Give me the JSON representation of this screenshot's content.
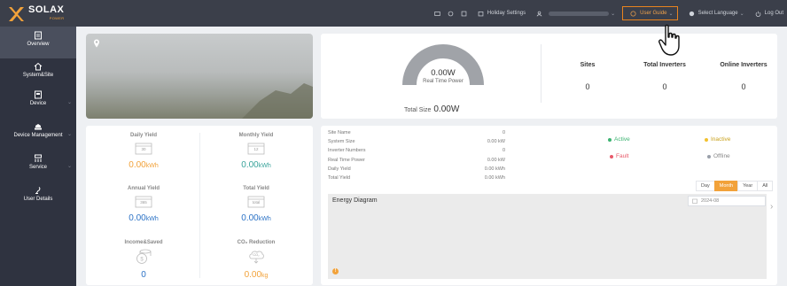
{
  "brand": {
    "name": "SOLAX",
    "sub": "POWER"
  },
  "topnav": {
    "holiday_settings": "Holiday Settings",
    "user_guide": "User Guide",
    "select_language": "Select Language",
    "log_out": "Log Out"
  },
  "sidebar": {
    "items": [
      {
        "label": "Overview",
        "icon": "overview-icon"
      },
      {
        "label": "System&Site",
        "icon": "home-icon"
      },
      {
        "label": "Device",
        "icon": "device-icon"
      },
      {
        "label": "Device Management",
        "icon": "device-management-icon"
      },
      {
        "label": "Service",
        "icon": "service-icon"
      },
      {
        "label": "User Details",
        "icon": "user-icon"
      }
    ]
  },
  "power": {
    "value": "0.00W",
    "label": "Real Time Power",
    "total_size_label": "Total Size",
    "total_size_value": "0.00W"
  },
  "stats": {
    "sites_label": "Sites",
    "sites_value": "0",
    "total_inverters_label": "Total Inverters",
    "total_inverters_value": "0",
    "online_inverters_label": "Online Inverters",
    "online_inverters_value": "0"
  },
  "yield": {
    "daily": {
      "label": "Daily Yield",
      "badge": "30",
      "value": "0.00",
      "unit": "kWh"
    },
    "monthly": {
      "label": "Monthly Yield",
      "badge": "12",
      "value": "0.00",
      "unit": "kWh"
    },
    "annual": {
      "label": "Annual Yield",
      "badge": "365",
      "value": "0.00",
      "unit": "kWh"
    },
    "total": {
      "label": "Total Yield",
      "badge": "total",
      "value": "0.00",
      "unit": "kWh"
    },
    "income": {
      "label": "Income&Saved",
      "value": "0"
    },
    "co2": {
      "label": "CO₂ Reduction",
      "badge": "CO₂",
      "value": "0.00",
      "unit": "kg"
    }
  },
  "site_info": [
    {
      "key": "Site Name",
      "value": "0"
    },
    {
      "key": "System Size",
      "value": "0.00 kW"
    },
    {
      "key": "Inverter Numbers",
      "value": "0"
    },
    {
      "key": "Real Time Power",
      "value": "0.00 kW"
    },
    {
      "key": "Daily Yield",
      "value": "0.00 kWh"
    },
    {
      "key": "Total Yield",
      "value": "0.00 kWh"
    }
  ],
  "status": {
    "active": "Active",
    "inactive": "Inactive",
    "fault": "Fault",
    "offline": "Offline"
  },
  "range": {
    "day": "Day",
    "month": "Month",
    "year": "Year",
    "all": "All"
  },
  "diagram": {
    "title": "Energy Diagram",
    "date": "2024-08"
  },
  "colors": {
    "accent": "#f2a23a",
    "topbar": "#3b3f4a",
    "sidebar": "#2f3340",
    "active_dot": "#3cb371",
    "inactive_dot": "#f2c12e",
    "fault_dot": "#e85a6a",
    "offline_dot": "#9aa0aa"
  }
}
